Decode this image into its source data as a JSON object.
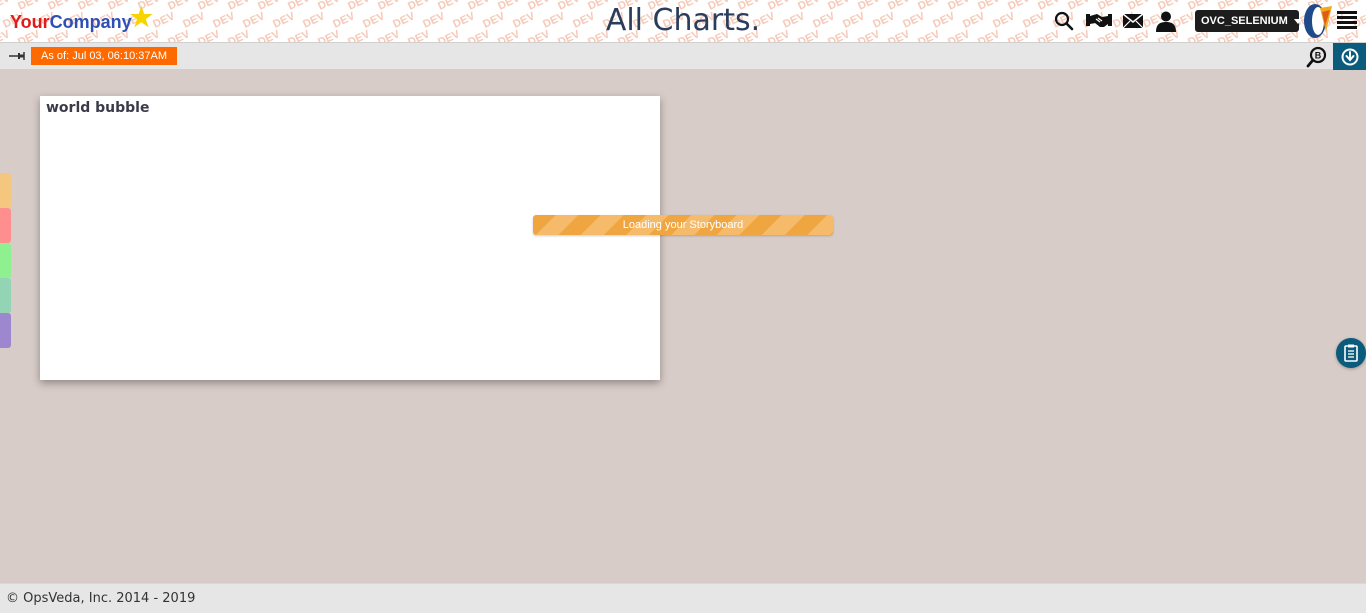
{
  "header": {
    "logo_part1": "Your",
    "logo_part2": "Company",
    "logo_star": "★",
    "watermark_word": "DEV",
    "title": "All Charts.",
    "icons": [
      "search-icon",
      "handshake-icon",
      "mail-icon",
      "user-icon"
    ],
    "user_selector": "OVC_SELENIUM"
  },
  "toolbar": {
    "as_of": "As of: Jul 03, 06:10:37AM"
  },
  "side_tabs": {
    "colors": [
      "#f4c67e",
      "#ff8f8f",
      "#8ff08f",
      "#93d4b4",
      "#9d88d0"
    ]
  },
  "card": {
    "title": "world bubble"
  },
  "loading": {
    "text": "Loading your Storyboard"
  },
  "footer": {
    "copyright": "© OpsVeda, Inc. 2014 - 2019"
  },
  "colors": {
    "accent_orange": "#ff6a00",
    "brand_blue": "#0a5b7c",
    "background": "#d8ccc8"
  }
}
